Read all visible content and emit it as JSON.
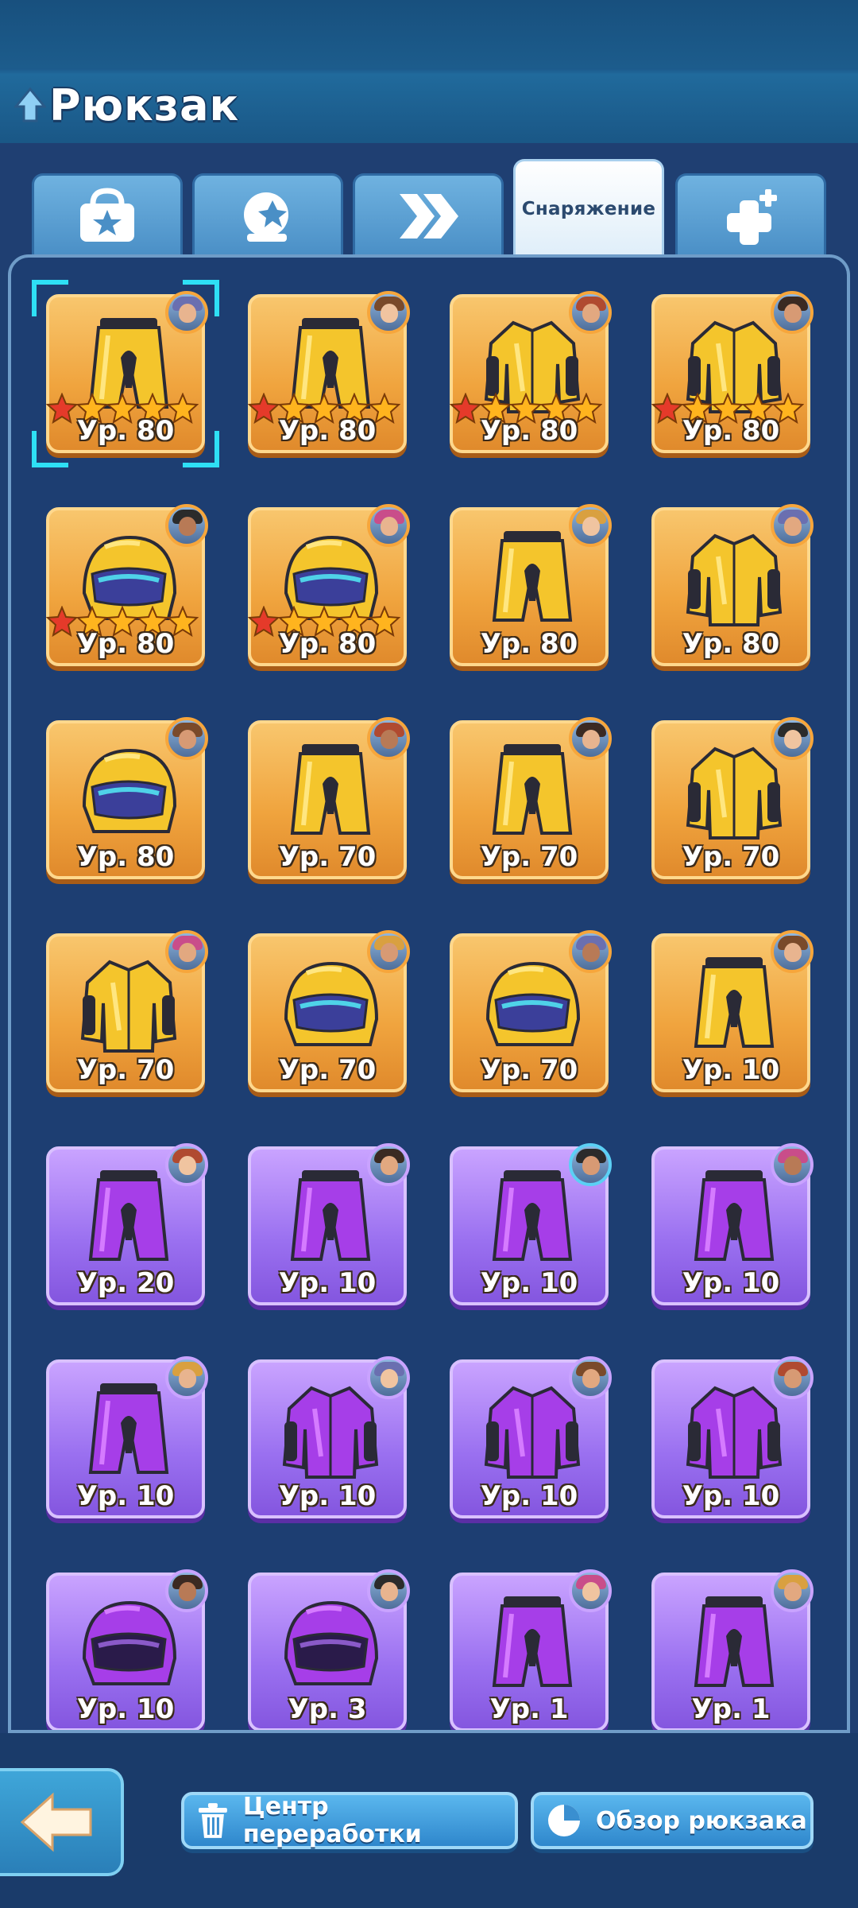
{
  "header": {
    "title": "Рюкзак"
  },
  "tabs": [
    {
      "icon": "bag-star-icon",
      "label": ""
    },
    {
      "icon": "crystal-ball-icon",
      "label": ""
    },
    {
      "icon": "double-chevron-icon",
      "label": ""
    },
    {
      "icon": "",
      "label": "Снаряжение"
    },
    {
      "icon": "plus-cross-icon",
      "label": ""
    }
  ],
  "items": [
    {
      "kind": "pants",
      "rarity": "gold",
      "level": "Ур. 80",
      "stars": true,
      "selected": true
    },
    {
      "kind": "pants",
      "rarity": "gold",
      "level": "Ур. 80",
      "stars": true
    },
    {
      "kind": "jacket",
      "rarity": "gold",
      "level": "Ур. 80",
      "stars": true
    },
    {
      "kind": "jacket",
      "rarity": "gold",
      "level": "Ур. 80",
      "stars": true
    },
    {
      "kind": "helmet",
      "rarity": "gold",
      "level": "Ур. 80",
      "stars": true
    },
    {
      "kind": "helmet",
      "rarity": "gold",
      "level": "Ур. 80",
      "stars": true
    },
    {
      "kind": "pants",
      "rarity": "gold",
      "level": "Ур. 80"
    },
    {
      "kind": "jacket",
      "rarity": "gold",
      "level": "Ур. 80"
    },
    {
      "kind": "helmet",
      "rarity": "gold",
      "level": "Ур. 80"
    },
    {
      "kind": "pants",
      "rarity": "gold",
      "level": "Ур. 70"
    },
    {
      "kind": "pants",
      "rarity": "gold",
      "level": "Ур. 70"
    },
    {
      "kind": "jacket",
      "rarity": "gold",
      "level": "Ур. 70"
    },
    {
      "kind": "jacket",
      "rarity": "gold",
      "level": "Ур. 70"
    },
    {
      "kind": "helmet",
      "rarity": "gold",
      "level": "Ур. 70"
    },
    {
      "kind": "helmet",
      "rarity": "gold",
      "level": "Ур. 70"
    },
    {
      "kind": "pants",
      "rarity": "gold",
      "level": "Ур. 10"
    },
    {
      "kind": "pants",
      "rarity": "purple",
      "level": "Ур. 20"
    },
    {
      "kind": "pants",
      "rarity": "purple",
      "level": "Ур. 10"
    },
    {
      "kind": "pants",
      "rarity": "purple",
      "level": "Ур. 10"
    },
    {
      "kind": "pants",
      "rarity": "purple",
      "level": "Ур. 10"
    },
    {
      "kind": "pants",
      "rarity": "purple",
      "level": "Ур. 10"
    },
    {
      "kind": "jacket",
      "rarity": "purple",
      "level": "Ур. 10"
    },
    {
      "kind": "jacket",
      "rarity": "purple",
      "level": "Ур. 10"
    },
    {
      "kind": "jacket",
      "rarity": "purple",
      "level": "Ур. 10"
    },
    {
      "kind": "helmet",
      "rarity": "purple",
      "level": "Ур. 10"
    },
    {
      "kind": "helmet",
      "rarity": "purple",
      "level": "Ур. 3"
    },
    {
      "kind": "pants",
      "rarity": "purple",
      "level": "Ур. 1"
    },
    {
      "kind": "pants",
      "rarity": "purple",
      "level": "Ур. 1"
    }
  ],
  "footer": {
    "back_icon": "back-arrow-icon",
    "recycle_label": "Центр переработки",
    "recycle_icon": "trash-can-icon",
    "overview_label": "Обзор рюкзака",
    "overview_icon": "pie-chart-icon"
  },
  "colors": {
    "background": "#1f3f72",
    "gold_card": "#f0a43e",
    "purple_card": "#9a70f0",
    "tab": "#5a9fd4",
    "button": "#3a95d8"
  }
}
